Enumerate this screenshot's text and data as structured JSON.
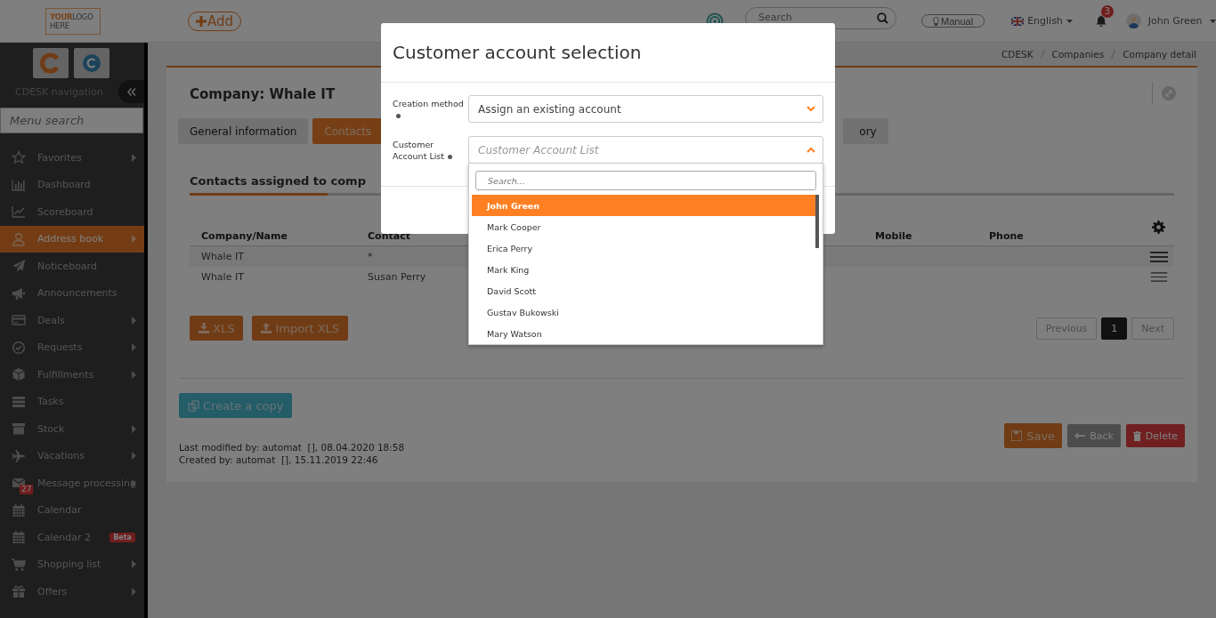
{
  "header": {
    "logo": {
      "accent": "YOUR",
      "text": "LOGO",
      "line2": "HERE"
    },
    "add_button": "Add",
    "search": {
      "placeholder": "Search"
    },
    "manual": "Manual",
    "language": "English",
    "notifications": "3",
    "user": "John Green"
  },
  "sidebar": {
    "title": "CDESK navigation",
    "search": {
      "placeholder": "Menu search"
    },
    "items": [
      {
        "label": "Favorites",
        "kind": "star",
        "submenu": true,
        "selected": false
      },
      {
        "label": "Dashboard",
        "kind": "bars",
        "submenu": false,
        "selected": false
      },
      {
        "label": "Scoreboard",
        "kind": "trend",
        "submenu": false,
        "selected": false
      },
      {
        "label": "Address book",
        "kind": "person",
        "submenu": true,
        "selected": true
      },
      {
        "label": "Noticeboard",
        "kind": "send",
        "submenu": false,
        "selected": false
      },
      {
        "label": "Announcements",
        "kind": "megaphone",
        "submenu": false,
        "selected": false
      },
      {
        "label": "Deals",
        "kind": "card",
        "submenu": true,
        "selected": false
      },
      {
        "label": "Requests",
        "kind": "check",
        "submenu": true,
        "selected": false
      },
      {
        "label": "Fulfillments",
        "kind": "cube",
        "submenu": true,
        "selected": false
      },
      {
        "label": "Tasks",
        "kind": "tasks",
        "submenu": false,
        "selected": false
      },
      {
        "label": "Stock",
        "kind": "archive",
        "submenu": true,
        "selected": false
      },
      {
        "label": "Vacations",
        "kind": "plane",
        "submenu": true,
        "selected": false
      },
      {
        "label": "Message processing",
        "kind": "envelope",
        "submenu": true,
        "selected": false,
        "badge": "27"
      },
      {
        "label": "Calendar",
        "kind": "calendar",
        "submenu": false,
        "selected": false
      },
      {
        "label": "Calendar 2",
        "kind": "calendar",
        "submenu": false,
        "selected": false,
        "tag": "Beta"
      },
      {
        "label": "Shopping list",
        "kind": "cart",
        "submenu": true,
        "selected": false
      },
      {
        "label": "Offers",
        "kind": "gift",
        "submenu": true,
        "selected": false
      }
    ]
  },
  "breadcrumb": [
    "CDESK",
    "Companies",
    "Company detail"
  ],
  "page": {
    "title": "Company: Whale IT",
    "tabs": [
      {
        "label": "General information",
        "selected": false
      },
      {
        "label": "Contacts",
        "selected": true
      },
      {
        "label": "ory",
        "selected": false
      }
    ],
    "section_title": "Contacts assigned to comp",
    "table": {
      "columns": [
        "Company/Name",
        "Contact",
        "Mobile",
        "Phone"
      ],
      "rows": [
        [
          "Whale IT",
          "*"
        ],
        [
          "Whale IT",
          "Susan Perry"
        ]
      ]
    },
    "export_buttons": [
      {
        "label": "XLS",
        "kind": "download"
      },
      {
        "label": "Import XLS",
        "kind": "upload"
      }
    ],
    "pagination": {
      "previous": {
        "label": "Previous",
        "disabled": true
      },
      "pages": [
        {
          "label": "1",
          "selected": true
        }
      ],
      "next": {
        "label": "Next",
        "disabled": true
      }
    },
    "copy_button": "Create a copy",
    "actions": [
      {
        "label": "Save",
        "kind": "save"
      },
      {
        "label": "Back",
        "kind": "back"
      },
      {
        "label": "Delete",
        "kind": "delete"
      }
    ],
    "audit": [
      "Last modified by: automat  [], 08.04.2020 18:58",
      "Created by: automat  [], 15.11.2019 22:46"
    ]
  },
  "modal": {
    "title": "Customer account selection",
    "fields": [
      {
        "label": "Creation method",
        "value": "Assign an existing account",
        "expanded": false
      },
      {
        "label": "Customer Account List",
        "placeholder": "Customer Account List",
        "expanded": true
      }
    ],
    "dropdown": {
      "search": {
        "placeholder": "Search..."
      },
      "options": [
        {
          "label": "John Green",
          "selected": true
        },
        {
          "label": "Mark Cooper",
          "selected": false
        },
        {
          "label": "Erica Perry",
          "selected": false
        },
        {
          "label": "Mark King",
          "selected": false
        },
        {
          "label": "David Scott",
          "selected": false
        },
        {
          "label": "Gustav Bukowski",
          "selected": false
        },
        {
          "label": "Mary Watson",
          "selected": false
        }
      ]
    }
  }
}
